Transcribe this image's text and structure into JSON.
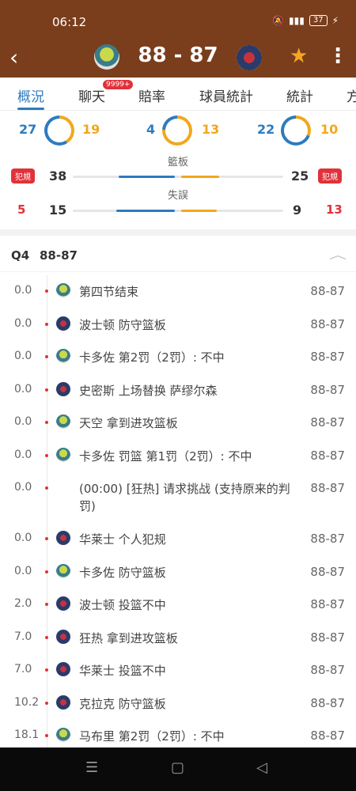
{
  "status": {
    "time": "06:12",
    "battery": "37"
  },
  "header": {
    "score": "88 - 87"
  },
  "tabs": [
    {
      "label": "概況"
    },
    {
      "label": "聊天",
      "badge": "9999+"
    },
    {
      "label": "賠率"
    },
    {
      "label": "球員統計"
    },
    {
      "label": "統計"
    },
    {
      "label": "方"
    }
  ],
  "stats": {
    "rings": [
      {
        "home": "27",
        "away": "19",
        "home_share": 0.59
      },
      {
        "home": "4",
        "away": "13",
        "home_share": 0.24
      },
      {
        "home": "22",
        "away": "10",
        "home_share": 0.69
      }
    ],
    "rebounds": {
      "title": "籃板",
      "home": "38",
      "away": "25",
      "tag": "犯規",
      "home_share": 0.6
    },
    "turnovers": {
      "title": "失誤",
      "home": "15",
      "away": "9",
      "home_fouls": "5",
      "away_fouls": "13",
      "home_share": 0.62
    }
  },
  "quarter": {
    "label": "Q4",
    "score": "88-87"
  },
  "plays": [
    {
      "time": "0.0",
      "team": "home",
      "desc": "第四节结束",
      "score": "88-87"
    },
    {
      "time": "0.0",
      "team": "away",
      "desc": "波士顿 防守篮板",
      "score": "88-87"
    },
    {
      "time": "0.0",
      "team": "home",
      "desc": "卡多佐 第2罚（2罚）: 不中",
      "score": "88-87"
    },
    {
      "time": "0.0",
      "team": "away",
      "desc": "史密斯 上场替换 萨缪尔森",
      "score": "88-87"
    },
    {
      "time": "0.0",
      "team": "home",
      "desc": "天空 拿到进攻篮板",
      "score": "88-87"
    },
    {
      "time": "0.0",
      "team": "home",
      "desc": "卡多佐 罚篮 第1罚（2罚）: 不中",
      "score": "88-87"
    },
    {
      "time": "0.0",
      "team": "none",
      "desc": "(00:00) [狂热] 请求挑战 (支持原来的判罚)",
      "score": "88-87"
    },
    {
      "time": "0.0",
      "team": "away",
      "desc": "华莱士 个人犯规",
      "score": "88-87"
    },
    {
      "time": "0.0",
      "team": "home",
      "desc": "卡多佐 防守篮板",
      "score": "88-87"
    },
    {
      "time": "2.0",
      "team": "away",
      "desc": "波士顿 投篮不中",
      "score": "88-87"
    },
    {
      "time": "7.0",
      "team": "away",
      "desc": "狂热 拿到进攻篮板",
      "score": "88-87"
    },
    {
      "time": "7.0",
      "team": "away",
      "desc": "华莱士 投篮不中",
      "score": "88-87"
    },
    {
      "time": "10.2",
      "team": "away",
      "desc": "克拉克 防守篮板",
      "score": "88-87"
    },
    {
      "time": "18.1",
      "team": "home",
      "desc": "马布里 第2罚（2罚）: 不中",
      "score": "88-87"
    }
  ],
  "colors": {
    "header": "#7a3e1d",
    "home": "#2d7bbf",
    "away": "#f0a81c",
    "foul": "#e0323a"
  }
}
